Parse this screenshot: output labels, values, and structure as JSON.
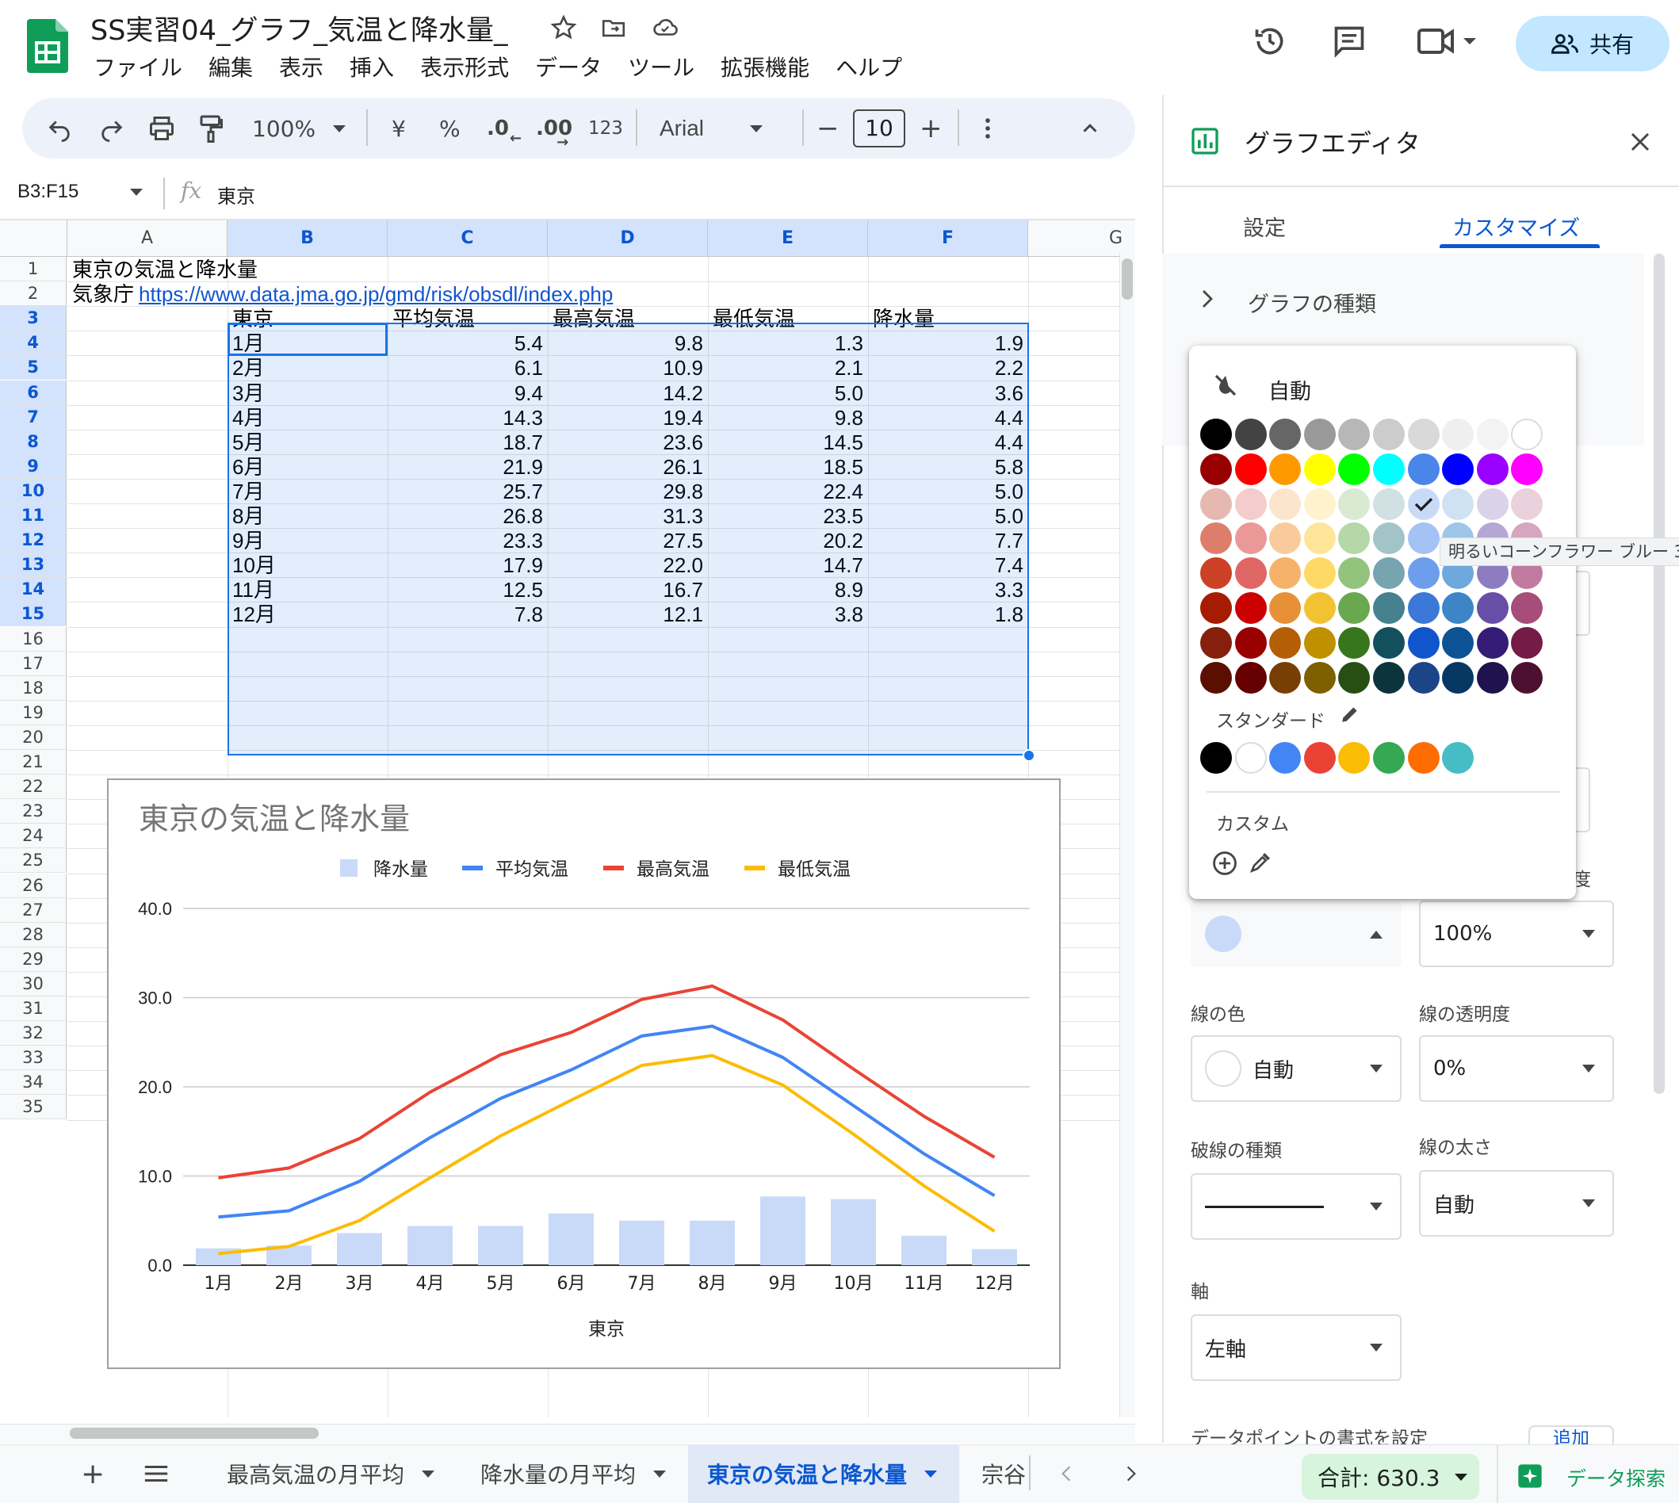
{
  "app": {
    "title": "SS実習04_グラフ_気温と降水量_",
    "menu": [
      "ファイル",
      "編集",
      "表示",
      "挿入",
      "表示形式",
      "データ",
      "ツール",
      "拡張機能",
      "ヘルプ"
    ],
    "share_label": "共有"
  },
  "toolbar": {
    "zoom": "100%",
    "currency": "¥",
    "percent": "%",
    "dec_less": ".0",
    "dec_more": ".00",
    "format_123": "123",
    "font": "Arial",
    "font_size": "10",
    "minus": "−",
    "plus": "+"
  },
  "formula_bar": {
    "name_box": "B3:F15",
    "fx": "fx",
    "content": "東京"
  },
  "columns": [
    "A",
    "B",
    "C",
    "D",
    "E",
    "F",
    "G"
  ],
  "rows": [
    "1",
    "2",
    "3",
    "4",
    "5",
    "6",
    "7",
    "8",
    "9",
    "10",
    "11",
    "12",
    "13",
    "14",
    "15",
    "16",
    "17",
    "18",
    "19",
    "20",
    "21",
    "22",
    "23",
    "24",
    "25",
    "26",
    "27",
    "28",
    "29",
    "30",
    "31",
    "32",
    "33",
    "34",
    "35"
  ],
  "sheet": {
    "a1": "東京の気温と降水量",
    "a2_prefix": "気象庁",
    "a2_link": "https://www.data.jma.go.jp/gmd/risk/obsdl/index.php",
    "header": [
      "東京",
      "平均気温",
      "最高気温",
      "最低気温",
      "降水量"
    ],
    "data": [
      [
        "1月",
        "5.4",
        "9.8",
        "1.3",
        "1.9"
      ],
      [
        "2月",
        "6.1",
        "10.9",
        "2.1",
        "2.2"
      ],
      [
        "3月",
        "9.4",
        "14.2",
        "5.0",
        "3.6"
      ],
      [
        "4月",
        "14.3",
        "19.4",
        "9.8",
        "4.4"
      ],
      [
        "5月",
        "18.7",
        "23.6",
        "14.5",
        "4.4"
      ],
      [
        "6月",
        "21.9",
        "26.1",
        "18.5",
        "5.8"
      ],
      [
        "7月",
        "25.7",
        "29.8",
        "22.4",
        "5.0"
      ],
      [
        "8月",
        "26.8",
        "31.3",
        "23.5",
        "5.0"
      ],
      [
        "9月",
        "23.3",
        "27.5",
        "20.2",
        "7.7"
      ],
      [
        "10月",
        "17.9",
        "22.0",
        "14.7",
        "7.4"
      ],
      [
        "11月",
        "12.5",
        "16.7",
        "8.9",
        "3.3"
      ],
      [
        "12月",
        "7.8",
        "12.1",
        "3.8",
        "1.8"
      ]
    ]
  },
  "chart_data": {
    "type": "line",
    "title": "東京の気温と降水量",
    "xlabel": "東京",
    "ylabel": "",
    "categories": [
      "1月",
      "2月",
      "3月",
      "4月",
      "5月",
      "6月",
      "7月",
      "8月",
      "9月",
      "10月",
      "11月",
      "12月"
    ],
    "ylim": [
      0,
      40
    ],
    "yticks": [
      "40.0",
      "30.0",
      "20.0",
      "10.0",
      "0.0"
    ],
    "legend_position": "top",
    "series": [
      {
        "name": "降水量",
        "kind": "bar",
        "color": "#c9daf8",
        "values": [
          1.9,
          2.2,
          3.6,
          4.4,
          4.4,
          5.8,
          5.0,
          5.0,
          7.7,
          7.4,
          3.3,
          1.8
        ]
      },
      {
        "name": "平均気温",
        "kind": "line",
        "color": "#4285f4",
        "values": [
          5.4,
          6.1,
          9.4,
          14.3,
          18.7,
          21.9,
          25.7,
          26.8,
          23.3,
          17.9,
          12.5,
          7.8
        ]
      },
      {
        "name": "最高気温",
        "kind": "line",
        "color": "#ea4335",
        "values": [
          9.8,
          10.9,
          14.2,
          19.4,
          23.6,
          26.1,
          29.8,
          31.3,
          27.5,
          22.0,
          16.7,
          12.1
        ]
      },
      {
        "name": "最低気温",
        "kind": "line",
        "color": "#fbbc04",
        "values": [
          1.3,
          2.1,
          5.0,
          9.8,
          14.5,
          18.5,
          22.4,
          23.5,
          20.2,
          14.7,
          8.9,
          3.8
        ]
      }
    ]
  },
  "editor": {
    "title": "グラフエディタ",
    "tab_setup": "設定",
    "tab_customize": "カスタマイズ",
    "section_chart_type": "グラフの種類",
    "partial_label_right": "度",
    "fill_opacity_value": "100%",
    "line_color_label": "線の色",
    "line_color_value": "自動",
    "line_opacity_label": "線の透明度",
    "line_opacity_value": "0%",
    "dash_label": "破線の種類",
    "thickness_label": "線の太さ",
    "thickness_value": "自動",
    "axis_label": "軸",
    "axis_value": "左軸",
    "datapoint_label": "データポイントの書式を設定",
    "add_label": "追加"
  },
  "palette": {
    "auto_label": "自動",
    "standard_label": "スタンダード",
    "custom_label": "カスタム",
    "tooltip": "明るいコーンフラワー ブルー 3",
    "selected": "#c9daf8",
    "rows": [
      [
        "#000000",
        "#434343",
        "#666666",
        "#999999",
        "#b7b7b7",
        "#cccccc",
        "#d9d9d9",
        "#efefef",
        "#f3f3f3",
        "#ffffff"
      ],
      [
        "#980000",
        "#ff0000",
        "#ff9900",
        "#ffff00",
        "#00ff00",
        "#00ffff",
        "#4a86e8",
        "#0000ff",
        "#9900ff",
        "#ff00ff"
      ],
      [
        "#e6b8af",
        "#f4cccc",
        "#fce5cd",
        "#fff2cc",
        "#d9ead3",
        "#d0e0e3",
        "#c9daf8",
        "#cfe2f3",
        "#d9d2e9",
        "#ead1dc"
      ],
      [
        "#dd7e6b",
        "#ea9999",
        "#f9cb9c",
        "#ffe599",
        "#b6d7a8",
        "#a2c4c9",
        "#a4c2f4",
        "#9fc5e8",
        "#b4a7d6",
        "#d5a6bd"
      ],
      [
        "#cc4125",
        "#e06666",
        "#f6b26b",
        "#ffd966",
        "#93c47d",
        "#76a5af",
        "#6d9eeb",
        "#6fa8dc",
        "#8e7cc3",
        "#c27ba0"
      ],
      [
        "#a61c00",
        "#cc0000",
        "#e69138",
        "#f1c232",
        "#6aa84f",
        "#45818e",
        "#3c78d8",
        "#3d85c6",
        "#674ea7",
        "#a64d79"
      ],
      [
        "#85200c",
        "#990000",
        "#b45f06",
        "#bf9000",
        "#38761d",
        "#134f5c",
        "#1155cc",
        "#0b5394",
        "#351c75",
        "#741b47"
      ],
      [
        "#5b0f00",
        "#660000",
        "#783f04",
        "#7f6000",
        "#274e13",
        "#0c343d",
        "#1c4587",
        "#073763",
        "#20124d",
        "#4c1130"
      ]
    ],
    "standard": [
      "#000000",
      "#ffffff",
      "#4285f4",
      "#ea4335",
      "#fbbc04",
      "#34a853",
      "#ff6d01",
      "#46bdc6"
    ]
  },
  "bottom": {
    "tabs": [
      "最高気温の月平均",
      "降水量の月平均",
      "東京の気温と降水量",
      "宗谷"
    ],
    "sum": "合計: 630.3",
    "explore": "データ探索"
  }
}
